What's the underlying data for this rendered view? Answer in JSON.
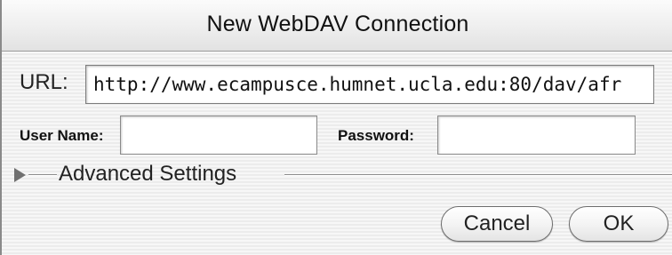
{
  "window": {
    "title": "New WebDAV Connection"
  },
  "form": {
    "url_label": "URL:",
    "url_value": "http://www.ecampusce.humnet.ucla.edu:80/dav/afr",
    "username_label": "User Name:",
    "username_value": "",
    "password_label": "Password:",
    "password_value": ""
  },
  "advanced": {
    "label": "Advanced Settings",
    "icon": "disclosure-triangle-right-icon"
  },
  "buttons": {
    "cancel_label": "Cancel",
    "ok_label": "OK"
  }
}
